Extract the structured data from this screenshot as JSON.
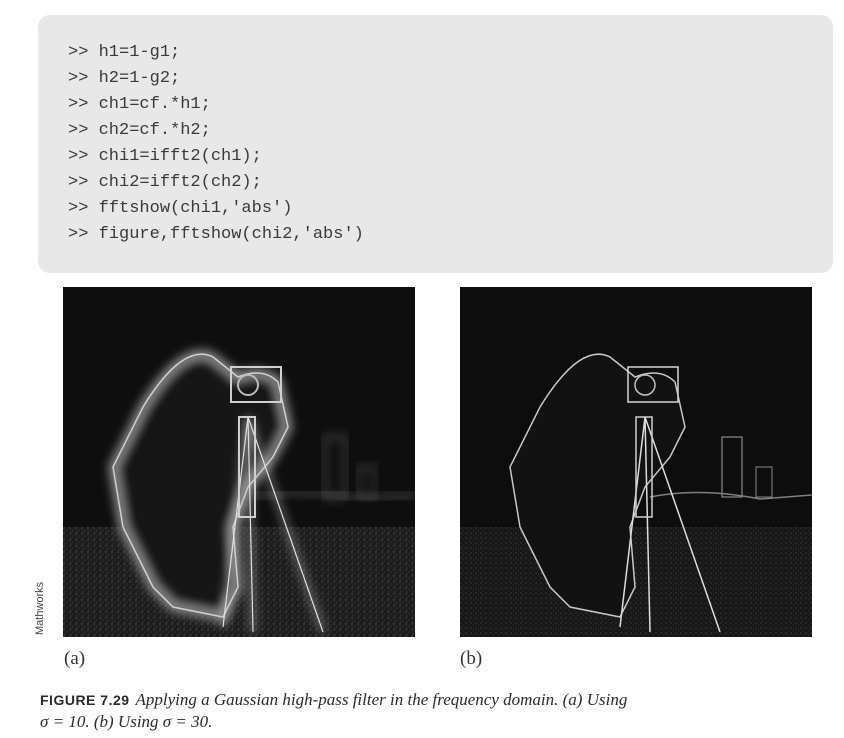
{
  "code_lines": [
    ">> h1=1-g1;",
    ">> h2=1-g2;",
    ">> ch1=cf.*h1;",
    ">> ch2=cf.*h2;",
    ">> chi1=ifft2(ch1);",
    ">> chi2=ifft2(ch2);",
    ">> fftshow(chi1,'abs')",
    ">> figure,fftshow(chi2,'abs')"
  ],
  "figures": [
    {
      "label": "(a)"
    },
    {
      "label": "(b)"
    }
  ],
  "credit": "Mathworks",
  "caption": {
    "label": "FIGURE 7.29",
    "line1": "Applying a Gaussian high-pass filter in the frequency domain. (a) Using",
    "line2": "σ = 10. (b) Using σ = 30."
  }
}
